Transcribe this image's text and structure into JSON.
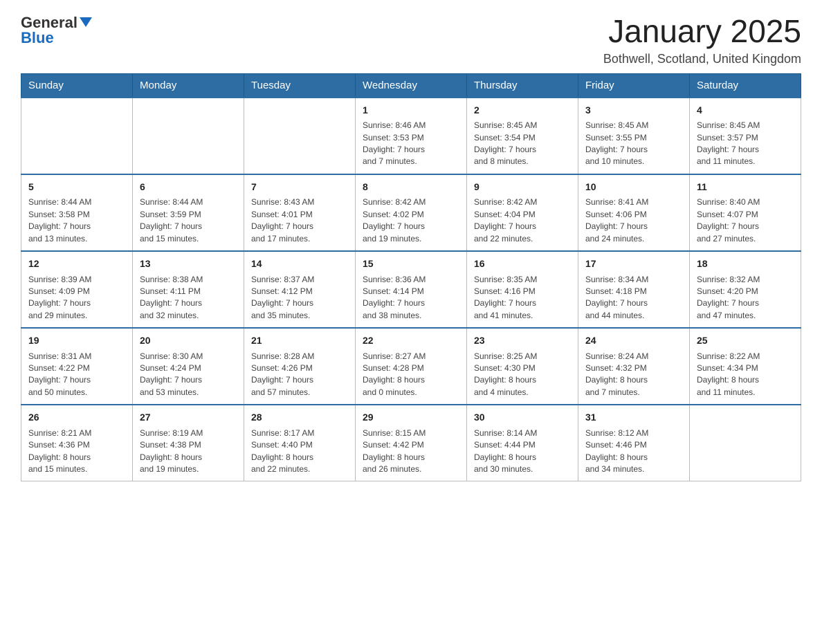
{
  "logo": {
    "text_general": "General",
    "text_blue": "Blue"
  },
  "title": "January 2025",
  "subtitle": "Bothwell, Scotland, United Kingdom",
  "days_of_week": [
    "Sunday",
    "Monday",
    "Tuesday",
    "Wednesday",
    "Thursday",
    "Friday",
    "Saturday"
  ],
  "weeks": [
    [
      {
        "day": "",
        "info": ""
      },
      {
        "day": "",
        "info": ""
      },
      {
        "day": "",
        "info": ""
      },
      {
        "day": "1",
        "info": "Sunrise: 8:46 AM\nSunset: 3:53 PM\nDaylight: 7 hours\nand 7 minutes."
      },
      {
        "day": "2",
        "info": "Sunrise: 8:45 AM\nSunset: 3:54 PM\nDaylight: 7 hours\nand 8 minutes."
      },
      {
        "day": "3",
        "info": "Sunrise: 8:45 AM\nSunset: 3:55 PM\nDaylight: 7 hours\nand 10 minutes."
      },
      {
        "day": "4",
        "info": "Sunrise: 8:45 AM\nSunset: 3:57 PM\nDaylight: 7 hours\nand 11 minutes."
      }
    ],
    [
      {
        "day": "5",
        "info": "Sunrise: 8:44 AM\nSunset: 3:58 PM\nDaylight: 7 hours\nand 13 minutes."
      },
      {
        "day": "6",
        "info": "Sunrise: 8:44 AM\nSunset: 3:59 PM\nDaylight: 7 hours\nand 15 minutes."
      },
      {
        "day": "7",
        "info": "Sunrise: 8:43 AM\nSunset: 4:01 PM\nDaylight: 7 hours\nand 17 minutes."
      },
      {
        "day": "8",
        "info": "Sunrise: 8:42 AM\nSunset: 4:02 PM\nDaylight: 7 hours\nand 19 minutes."
      },
      {
        "day": "9",
        "info": "Sunrise: 8:42 AM\nSunset: 4:04 PM\nDaylight: 7 hours\nand 22 minutes."
      },
      {
        "day": "10",
        "info": "Sunrise: 8:41 AM\nSunset: 4:06 PM\nDaylight: 7 hours\nand 24 minutes."
      },
      {
        "day": "11",
        "info": "Sunrise: 8:40 AM\nSunset: 4:07 PM\nDaylight: 7 hours\nand 27 minutes."
      }
    ],
    [
      {
        "day": "12",
        "info": "Sunrise: 8:39 AM\nSunset: 4:09 PM\nDaylight: 7 hours\nand 29 minutes."
      },
      {
        "day": "13",
        "info": "Sunrise: 8:38 AM\nSunset: 4:11 PM\nDaylight: 7 hours\nand 32 minutes."
      },
      {
        "day": "14",
        "info": "Sunrise: 8:37 AM\nSunset: 4:12 PM\nDaylight: 7 hours\nand 35 minutes."
      },
      {
        "day": "15",
        "info": "Sunrise: 8:36 AM\nSunset: 4:14 PM\nDaylight: 7 hours\nand 38 minutes."
      },
      {
        "day": "16",
        "info": "Sunrise: 8:35 AM\nSunset: 4:16 PM\nDaylight: 7 hours\nand 41 minutes."
      },
      {
        "day": "17",
        "info": "Sunrise: 8:34 AM\nSunset: 4:18 PM\nDaylight: 7 hours\nand 44 minutes."
      },
      {
        "day": "18",
        "info": "Sunrise: 8:32 AM\nSunset: 4:20 PM\nDaylight: 7 hours\nand 47 minutes."
      }
    ],
    [
      {
        "day": "19",
        "info": "Sunrise: 8:31 AM\nSunset: 4:22 PM\nDaylight: 7 hours\nand 50 minutes."
      },
      {
        "day": "20",
        "info": "Sunrise: 8:30 AM\nSunset: 4:24 PM\nDaylight: 7 hours\nand 53 minutes."
      },
      {
        "day": "21",
        "info": "Sunrise: 8:28 AM\nSunset: 4:26 PM\nDaylight: 7 hours\nand 57 minutes."
      },
      {
        "day": "22",
        "info": "Sunrise: 8:27 AM\nSunset: 4:28 PM\nDaylight: 8 hours\nand 0 minutes."
      },
      {
        "day": "23",
        "info": "Sunrise: 8:25 AM\nSunset: 4:30 PM\nDaylight: 8 hours\nand 4 minutes."
      },
      {
        "day": "24",
        "info": "Sunrise: 8:24 AM\nSunset: 4:32 PM\nDaylight: 8 hours\nand 7 minutes."
      },
      {
        "day": "25",
        "info": "Sunrise: 8:22 AM\nSunset: 4:34 PM\nDaylight: 8 hours\nand 11 minutes."
      }
    ],
    [
      {
        "day": "26",
        "info": "Sunrise: 8:21 AM\nSunset: 4:36 PM\nDaylight: 8 hours\nand 15 minutes."
      },
      {
        "day": "27",
        "info": "Sunrise: 8:19 AM\nSunset: 4:38 PM\nDaylight: 8 hours\nand 19 minutes."
      },
      {
        "day": "28",
        "info": "Sunrise: 8:17 AM\nSunset: 4:40 PM\nDaylight: 8 hours\nand 22 minutes."
      },
      {
        "day": "29",
        "info": "Sunrise: 8:15 AM\nSunset: 4:42 PM\nDaylight: 8 hours\nand 26 minutes."
      },
      {
        "day": "30",
        "info": "Sunrise: 8:14 AM\nSunset: 4:44 PM\nDaylight: 8 hours\nand 30 minutes."
      },
      {
        "day": "31",
        "info": "Sunrise: 8:12 AM\nSunset: 4:46 PM\nDaylight: 8 hours\nand 34 minutes."
      },
      {
        "day": "",
        "info": ""
      }
    ]
  ]
}
